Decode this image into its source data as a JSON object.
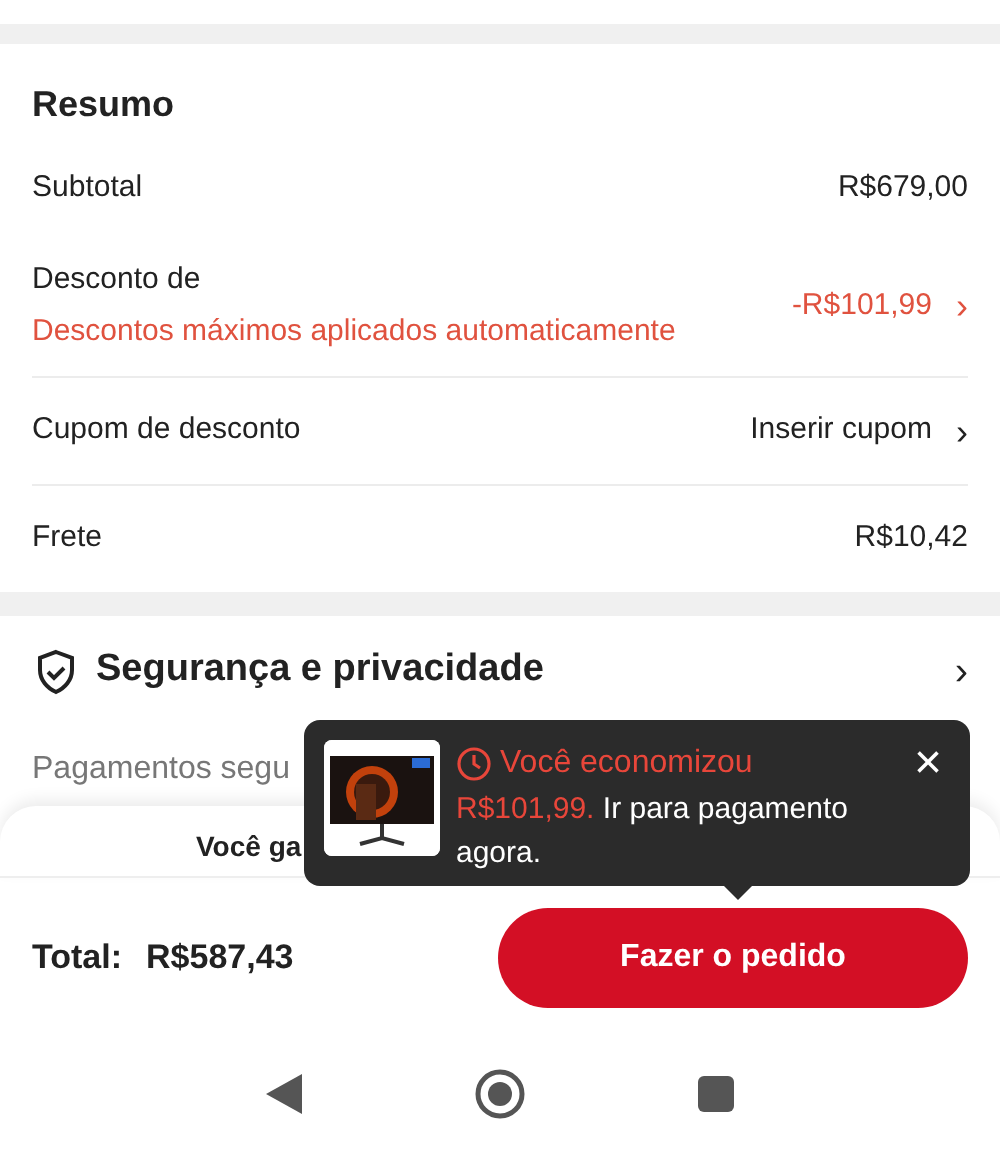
{
  "summary": {
    "title": "Resumo",
    "rows": [
      {
        "kind": "plain",
        "label": "Subtotal",
        "value": "R$679,00"
      },
      {
        "kind": "discount",
        "label": "Desconto de",
        "note": "Descontos máximos aplicados automaticamente",
        "value": "-R$101,99",
        "chevron": "›"
      },
      {
        "kind": "link",
        "label": "Cupom de desconto",
        "value": "Inserir cupom",
        "chevron": "›"
      },
      {
        "kind": "plain",
        "label": "Frete",
        "value": "R$10,42"
      }
    ]
  },
  "security": {
    "title": "Segurança e privacidade",
    "chevron": "›",
    "text_parts": [
      "Pagamentos segu"
    ]
  },
  "credits": {
    "text_parts": [
      "Você ga"
    ]
  },
  "toast": {
    "title": "Você economizou",
    "amount": "R$101,99.",
    "message": " Ir para pagamento agora.",
    "close": "×"
  },
  "footer": {
    "total_label": "Total:",
    "total_value": "R$587,43",
    "button": "Fazer o pedido"
  }
}
